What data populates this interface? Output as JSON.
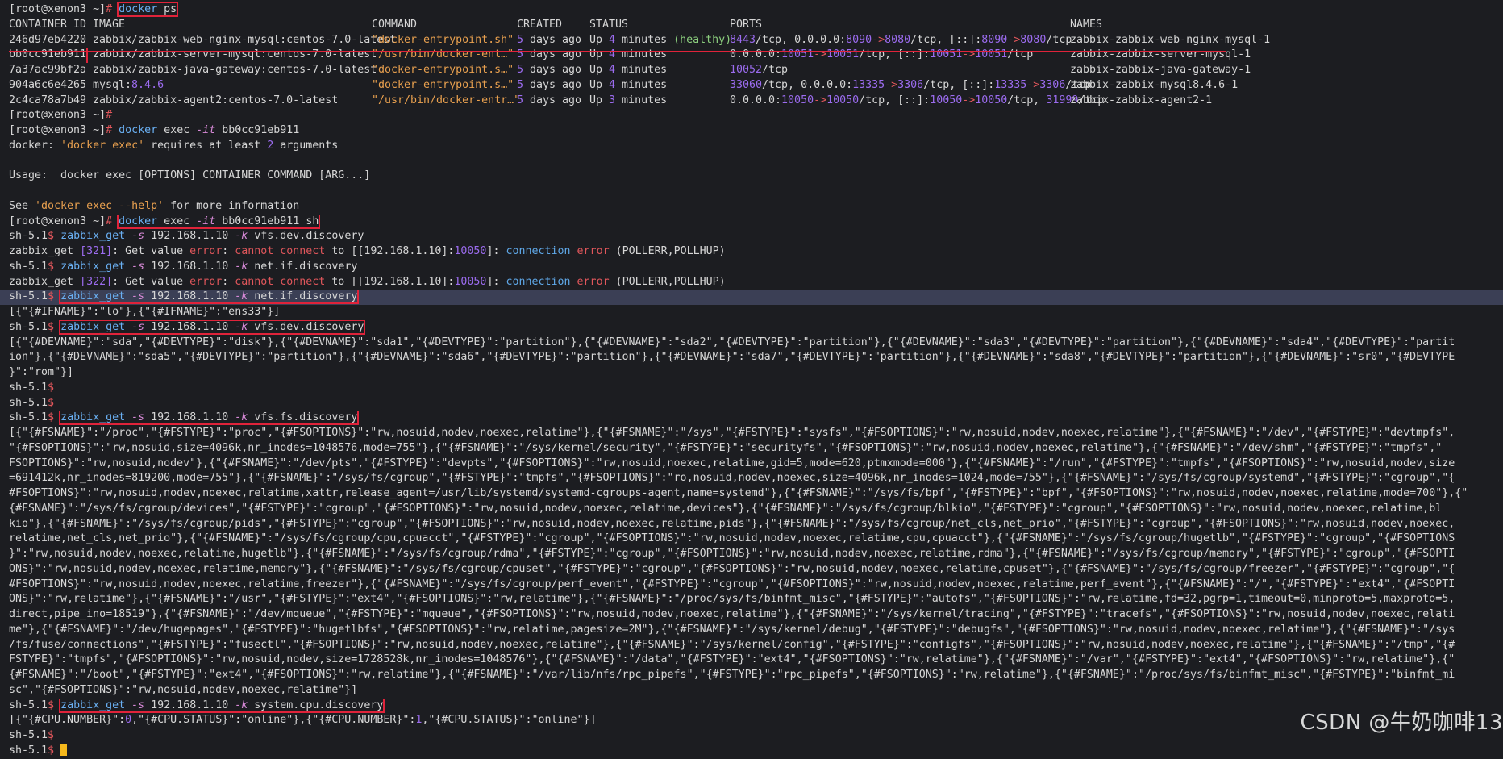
{
  "prompt": {
    "root_user": "[root@xenon3 ~]",
    "root_sym": "#",
    "sh": "sh-5.1",
    "sh_sym": "$"
  },
  "docker_ps": {
    "command": "docker ps",
    "headers": [
      "CONTAINER ID",
      "IMAGE",
      "COMMAND",
      "CREATED",
      "STATUS",
      "PORTS",
      "NAMES"
    ],
    "rows": [
      [
        "246d97eb4220",
        "zabbix/zabbix-web-nginx-mysql:centos-7.0-latest",
        "\"docker-entrypoint.sh\"",
        "5 days ago",
        "Up 4 minutes (healthy)",
        "8443/tcp, 0.0.0.0:8090->8080/tcp, [::]:8090->8080/tcp",
        "zabbix-zabbix-web-nginx-mysql-1"
      ],
      [
        "bb0cc91eb911",
        "zabbix/zabbix-server-mysql:centos-7.0-latest",
        "\"/usr/bin/docker-ent…\"",
        "5 days ago",
        "Up 4 minutes",
        "0.0.0.0:10051->10051/tcp, [::]:10051->10051/tcp",
        "zabbix-zabbix-server-mysql-1"
      ],
      [
        "7a37ac99bf2a",
        "zabbix/zabbix-java-gateway:centos-7.0-latest",
        "\"docker-entrypoint.s…\"",
        "5 days ago",
        "Up 4 minutes",
        "10052/tcp",
        "zabbix-zabbix-java-gateway-1"
      ],
      [
        "904a6c6e4265",
        "mysql:8.4.6",
        "\"docker-entrypoint.s…\"",
        "5 days ago",
        "Up 4 minutes",
        "33060/tcp, 0.0.0.0:13335->3306/tcp, [::]:13335->3306/tcp",
        "zabbix-zabbix-mysql8.4.6-1"
      ],
      [
        "2c4ca78a7b49",
        "zabbix/zabbix-agent2:centos-7.0-latest",
        "\"/usr/bin/docker-entr…\"",
        "5 days ago",
        "Up 3 minutes",
        "0.0.0.0:10050->10050/tcp, [::]:10050->10050/tcp, 31999/tcp",
        "zabbix-zabbix-agent2-1"
      ]
    ]
  },
  "exec1": {
    "command": "docker exec -it bb0cc91eb911",
    "err": "docker: 'docker exec' requires at least 2 arguments",
    "usage": "Usage:  docker exec [OPTIONS] CONTAINER COMMAND [ARG...]",
    "help": "See 'docker exec --help' for more information"
  },
  "exec2": {
    "command": "docker exec -it bb0cc91eb911 sh"
  },
  "commands": {
    "c1": "zabbix_get -s 192.168.1.10 -k vfs.dev.discovery",
    "e1": "zabbix_get [321]: Get value error: cannot connect to [[192.168.1.10]:10050]: connection error (POLLERR,POLLHUP)",
    "c2": "zabbix_get -s 192.168.1.10 -k net.if.discovery",
    "e2": "zabbix_get [322]: Get value error: cannot connect to [[192.168.1.10]:10050]: connection error (POLLERR,POLLHUP)",
    "c3": "zabbix_get -s 192.168.1.10 -k net.if.discovery",
    "o3": "[{\"{#IFNAME}\":\"lo\"},{\"{#IFNAME}\":\"ens33\"}]",
    "c4": "zabbix_get -s 192.168.1.10 -k vfs.dev.discovery",
    "o4": [
      "[{\"{#DEVNAME}\":\"sda\",\"{#DEVTYPE}\":\"disk\"},{\"{#DEVNAME}\":\"sda1\",\"{#DEVTYPE}\":\"partition\"},{\"{#DEVNAME}\":\"sda2\",\"{#DEVTYPE}\":\"partition\"},{\"{#DEVNAME}\":\"sda3\",\"{#DEVTYPE}\":\"partition\"},{\"{#DEVNAME}\":\"sda4\",\"{#DEVTYPE}\":\"partit",
      "ion\"},{\"{#DEVNAME}\":\"sda5\",\"{#DEVTYPE}\":\"partition\"},{\"{#DEVNAME}\":\"sda6\",\"{#DEVTYPE}\":\"partition\"},{\"{#DEVNAME}\":\"sda7\",\"{#DEVTYPE}\":\"partition\"},{\"{#DEVNAME}\":\"sda8\",\"{#DEVTYPE}\":\"partition\"},{\"{#DEVNAME}\":\"sr0\",\"{#DEVTYPE",
      "}\":\"rom\"}]"
    ],
    "c5": "zabbix_get -s 192.168.1.10 -k vfs.fs.discovery",
    "o5": [
      "[{\"{#FSNAME}\":\"/proc\",\"{#FSTYPE}\":\"proc\",\"{#FSOPTIONS}\":\"rw,nosuid,nodev,noexec,relatime\"},{\"{#FSNAME}\":\"/sys\",\"{#FSTYPE}\":\"sysfs\",\"{#FSOPTIONS}\":\"rw,nosuid,nodev,noexec,relatime\"},{\"{#FSNAME}\":\"/dev\",\"{#FSTYPE}\":\"devtmpfs\",",
      "\"{#FSOPTIONS}\":\"rw,nosuid,size=4096k,nr_inodes=1048576,mode=755\"},{\"{#FSNAME}\":\"/sys/kernel/security\",\"{#FSTYPE}\":\"securityfs\",\"{#FSOPTIONS}\":\"rw,nosuid,nodev,noexec,relatime\"},{\"{#FSNAME}\":\"/dev/shm\",\"{#FSTYPE}\":\"tmpfs\",\"",
      "FSOPTIONS}\":\"rw,nosuid,nodev\"},{\"{#FSNAME}\":\"/dev/pts\",\"{#FSTYPE}\":\"devpts\",\"{#FSOPTIONS}\":\"rw,nosuid,noexec,relatime,gid=5,mode=620,ptmxmode=000\"},{\"{#FSNAME}\":\"/run\",\"{#FSTYPE}\":\"tmpfs\",\"{#FSOPTIONS}\":\"rw,nosuid,nodev,size",
      "=691412k,nr_inodes=819200,mode=755\"},{\"{#FSNAME}\":\"/sys/fs/cgroup\",\"{#FSTYPE}\":\"tmpfs\",\"{#FSOPTIONS}\":\"ro,nosuid,nodev,noexec,size=4096k,nr_inodes=1024,mode=755\"},{\"{#FSNAME}\":\"/sys/fs/cgroup/systemd\",\"{#FSTYPE}\":\"cgroup\",\"{",
      "#FSOPTIONS}\":\"rw,nosuid,nodev,noexec,relatime,xattr,release_agent=/usr/lib/systemd/systemd-cgroups-agent,name=systemd\"},{\"{#FSNAME}\":\"/sys/fs/bpf\",\"{#FSTYPE}\":\"bpf\",\"{#FSOPTIONS}\":\"rw,nosuid,nodev,noexec,relatime,mode=700\"},{\"",
      "{#FSNAME}\":\"/sys/fs/cgroup/devices\",\"{#FSTYPE}\":\"cgroup\",\"{#FSOPTIONS}\":\"rw,nosuid,nodev,noexec,relatime,devices\"},{\"{#FSNAME}\":\"/sys/fs/cgroup/blkio\",\"{#FSTYPE}\":\"cgroup\",\"{#FSOPTIONS}\":\"rw,nosuid,nodev,noexec,relatime,bl",
      "kio\"},{\"{#FSNAME}\":\"/sys/fs/cgroup/pids\",\"{#FSTYPE}\":\"cgroup\",\"{#FSOPTIONS}\":\"rw,nosuid,nodev,noexec,relatime,pids\"},{\"{#FSNAME}\":\"/sys/fs/cgroup/net_cls,net_prio\",\"{#FSTYPE}\":\"cgroup\",\"{#FSOPTIONS}\":\"rw,nosuid,nodev,noexec,",
      "relatime,net_cls,net_prio\"},{\"{#FSNAME}\":\"/sys/fs/cgroup/cpu,cpuacct\",\"{#FSTYPE}\":\"cgroup\",\"{#FSOPTIONS}\":\"rw,nosuid,nodev,noexec,relatime,cpu,cpuacct\"},{\"{#FSNAME}\":\"/sys/fs/cgroup/hugetlb\",\"{#FSTYPE}\":\"cgroup\",\"{#FSOPTIONS",
      "}\":\"rw,nosuid,nodev,noexec,relatime,hugetlb\"},{\"{#FSNAME}\":\"/sys/fs/cgroup/rdma\",\"{#FSTYPE}\":\"cgroup\",\"{#FSOPTIONS}\":\"rw,nosuid,nodev,noexec,relatime,rdma\"},{\"{#FSNAME}\":\"/sys/fs/cgroup/memory\",\"{#FSTYPE}\":\"cgroup\",\"{#FSOPTI",
      "ONS}\":\"rw,nosuid,nodev,noexec,relatime,memory\"},{\"{#FSNAME}\":\"/sys/fs/cgroup/cpuset\",\"{#FSTYPE}\":\"cgroup\",\"{#FSOPTIONS}\":\"rw,nosuid,nodev,noexec,relatime,cpuset\"},{\"{#FSNAME}\":\"/sys/fs/cgroup/freezer\",\"{#FSTYPE}\":\"cgroup\",\"{",
      "#FSOPTIONS}\":\"rw,nosuid,nodev,noexec,relatime,freezer\"},{\"{#FSNAME}\":\"/sys/fs/cgroup/perf_event\",\"{#FSTYPE}\":\"cgroup\",\"{#FSOPTIONS}\":\"rw,nosuid,nodev,noexec,relatime,perf_event\"},{\"{#FSNAME}\":\"/\",\"{#FSTYPE}\":\"ext4\",\"{#FSOPTI",
      "ONS}\":\"rw,relatime\"},{\"{#FSNAME}\":\"/usr\",\"{#FSTYPE}\":\"ext4\",\"{#FSOPTIONS}\":\"rw,relatime\"},{\"{#FSNAME}\":\"/proc/sys/fs/binfmt_misc\",\"{#FSTYPE}\":\"autofs\",\"{#FSOPTIONS}\":\"rw,relatime,fd=32,pgrp=1,timeout=0,minproto=5,maxproto=5,",
      "direct,pipe_ino=18519\"},{\"{#FSNAME}\":\"/dev/mqueue\",\"{#FSTYPE}\":\"mqueue\",\"{#FSOPTIONS}\":\"rw,nosuid,nodev,noexec,relatime\"},{\"{#FSNAME}\":\"/sys/kernel/tracing\",\"{#FSTYPE}\":\"tracefs\",\"{#FSOPTIONS}\":\"rw,nosuid,nodev,noexec,relati",
      "me\"},{\"{#FSNAME}\":\"/dev/hugepages\",\"{#FSTYPE}\":\"hugetlbfs\",\"{#FSOPTIONS}\":\"rw,relatime,pagesize=2M\"},{\"{#FSNAME}\":\"/sys/kernel/debug\",\"{#FSTYPE}\":\"debugfs\",\"{#FSOPTIONS}\":\"rw,nosuid,nodev,noexec,relatime\"},{\"{#FSNAME}\":\"/sys",
      "/fs/fuse/connections\",\"{#FSTYPE}\":\"fusectl\",\"{#FSOPTIONS}\":\"rw,nosuid,nodev,noexec,relatime\"},{\"{#FSNAME}\":\"/sys/kernel/config\",\"{#FSTYPE}\":\"configfs\",\"{#FSOPTIONS}\":\"rw,nosuid,nodev,noexec,relatime\"},{\"{#FSNAME}\":\"/tmp\",\"{#",
      "FSTYPE}\":\"tmpfs\",\"{#FSOPTIONS}\":\"rw,nosuid,nodev,size=1728528k,nr_inodes=1048576\"},{\"{#FSNAME}\":\"/data\",\"{#FSTYPE}\":\"ext4\",\"{#FSOPTIONS}\":\"rw,relatime\"},{\"{#FSNAME}\":\"/var\",\"{#FSTYPE}\":\"ext4\",\"{#FSOPTIONS}\":\"rw,relatime\"},{\"",
      "{#FSNAME}\":\"/boot\",\"{#FSTYPE}\":\"ext4\",\"{#FSOPTIONS}\":\"rw,relatime\"},{\"{#FSNAME}\":\"/var/lib/nfs/rpc_pipefs\",\"{#FSTYPE}\":\"rpc_pipefs\",\"{#FSOPTIONS}\":\"rw,relatime\"},{\"{#FSNAME}\":\"/proc/sys/fs/binfmt_misc\",\"{#FSTYPE}\":\"binfmt_mi",
      "sc\",\"{#FSOPTIONS}\":\"rw,nosuid,nodev,noexec,relatime\"}]"
    ],
    "c6": "zabbix_get -s 192.168.1.10 -k system.cpu.discovery",
    "o6": "[{\"{#CPU.NUMBER}\":0,\"{#CPU.STATUS}\":\"online\"},{\"{#CPU.NUMBER}\":1,\"{#CPU.STATUS}\":\"online\"}]"
  },
  "watermark": "CSDN @牛奶咖啡13",
  "colors": {
    "background": "#1c1d21",
    "highlight": "#e0233a",
    "cursor": "#f5b81c"
  }
}
